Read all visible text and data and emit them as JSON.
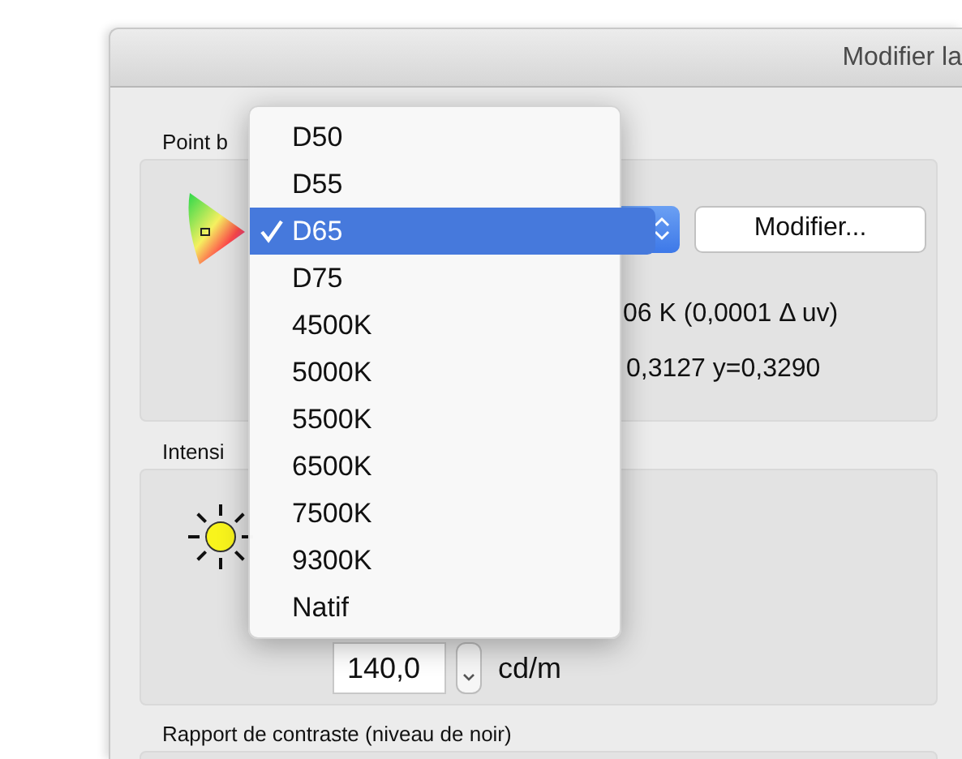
{
  "window": {
    "title": "Modifier la"
  },
  "white_point": {
    "label": "Point b",
    "button": "Modifier...",
    "temperature": "06 K (0,0001 Δ uv)",
    "cie": "0,3127 y=0,3290"
  },
  "intensity": {
    "label": "Intensi",
    "value": "140,0",
    "unit": "cd/m"
  },
  "contrast": {
    "label": "Rapport de contraste (niveau de noir)"
  },
  "menu": {
    "items": [
      {
        "label": "D50",
        "selected": false
      },
      {
        "label": "D55",
        "selected": false
      },
      {
        "label": "D65",
        "selected": true
      },
      {
        "label": "D75",
        "selected": false
      },
      {
        "label": "4500K",
        "selected": false
      },
      {
        "label": "5000K",
        "selected": false
      },
      {
        "label": "5500K",
        "selected": false
      },
      {
        "label": "6500K",
        "selected": false
      },
      {
        "label": "7500K",
        "selected": false
      },
      {
        "label": "9300K",
        "selected": false
      },
      {
        "label": "Natif",
        "selected": false
      }
    ]
  }
}
